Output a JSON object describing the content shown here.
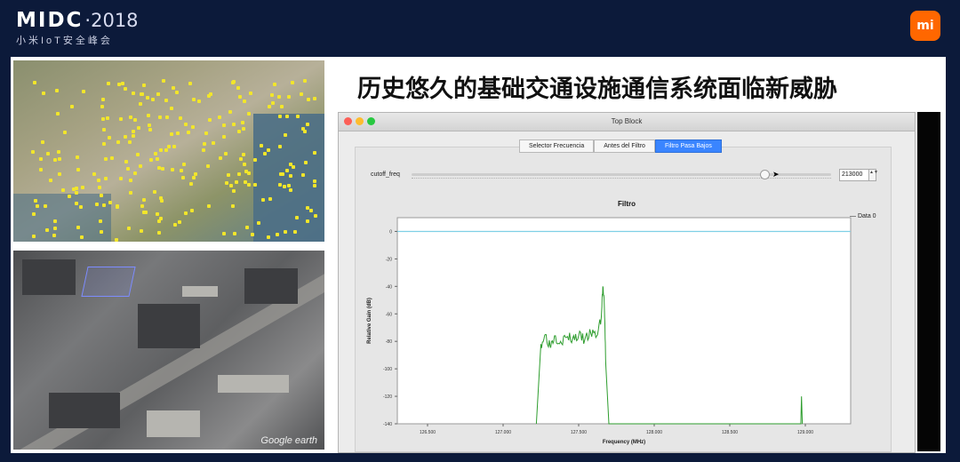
{
  "header": {
    "logo": {
      "brand": "MIDC",
      "year": "·2018",
      "subtitle": "小米IoT安全峰会"
    },
    "mi_logo": "mi"
  },
  "slide": {
    "title": "历史悠久的基础交通设施通信系统面临新威胁",
    "map_credit": "Google earth"
  },
  "app": {
    "window_title": "Top Block",
    "tabs": [
      {
        "label": "Selector Frecuencia",
        "active": false
      },
      {
        "label": "Antes del Filtro",
        "active": false
      },
      {
        "label": "Filtro Pasa Bajos",
        "active": true
      }
    ],
    "cutoff": {
      "label": "cutoff_freq",
      "value": "213000",
      "spinner_glyph": "▲▼",
      "slider_fraction": 0.84
    }
  },
  "chart_data": {
    "type": "line",
    "title": "Filtro",
    "xlabel": "Frequency (MHz)",
    "ylabel": "Relative Gain (dB)",
    "xlim": [
      126.3,
      129.3
    ],
    "ylim": [
      -140,
      10
    ],
    "xticks": [
      "126.500",
      "127.000",
      "127.500",
      "128.000",
      "128.500",
      "129.000"
    ],
    "yticks": [
      "0",
      "-20",
      "-40",
      "-60",
      "-80",
      "-100",
      "-120",
      "-140"
    ],
    "legend": "Data 0",
    "series": [
      {
        "name": "Data 0",
        "color": "#2e9d2e",
        "points": [
          [
            127.22,
            -140
          ],
          [
            127.25,
            -82
          ],
          [
            127.28,
            -75
          ],
          [
            127.31,
            -83
          ],
          [
            127.34,
            -76
          ],
          [
            127.38,
            -80
          ],
          [
            127.42,
            -77
          ],
          [
            127.46,
            -78
          ],
          [
            127.5,
            -76
          ],
          [
            127.54,
            -79
          ],
          [
            127.58,
            -74
          ],
          [
            127.62,
            -76
          ],
          [
            127.65,
            -62
          ],
          [
            127.66,
            -40
          ],
          [
            127.67,
            -55
          ],
          [
            127.68,
            -98
          ],
          [
            127.7,
            -140
          ],
          [
            128.97,
            -140
          ],
          [
            128.975,
            -120
          ],
          [
            128.98,
            -140
          ]
        ]
      }
    ],
    "reference_line": {
      "y": 0,
      "color": "#7fd0e6"
    }
  }
}
